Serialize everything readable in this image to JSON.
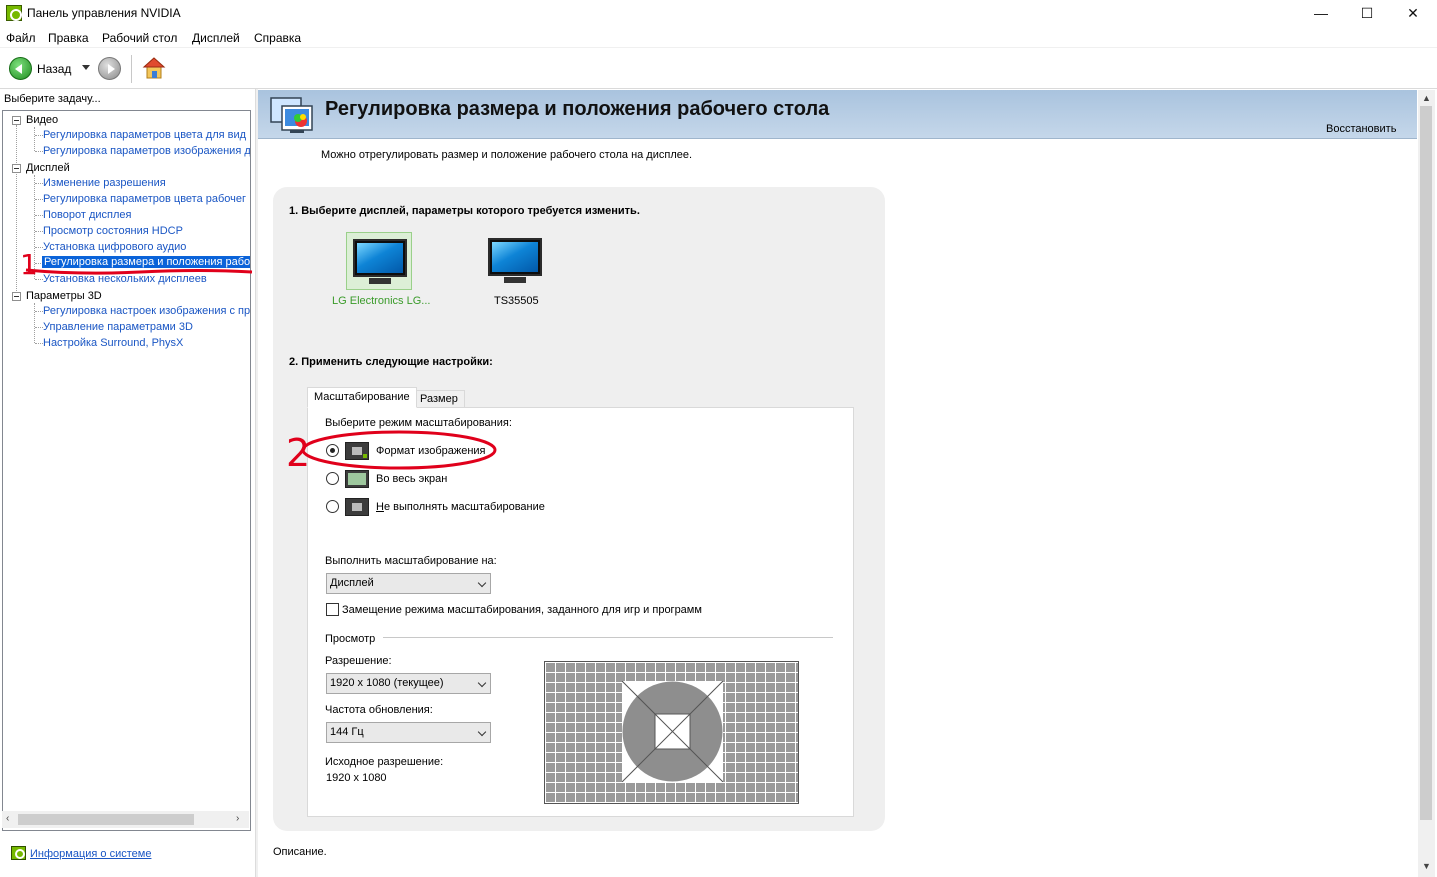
{
  "window": {
    "title": "Панель управления NVIDIA",
    "minimize": "—",
    "maximize": "☐",
    "close": "✕"
  },
  "menu": [
    "Файл",
    "Правка",
    "Рабочий стол",
    "Дисплей",
    "Справка"
  ],
  "toolbar": {
    "back_label": "Назад",
    "back_icon": "back-arrow-icon",
    "forward_icon": "forward-arrow-icon",
    "home_icon": "home-icon"
  },
  "sidebar": {
    "task_label": "Выберите задачу...",
    "categories": [
      {
        "label": "Видео",
        "items": [
          "Регулировка параметров цвета для вид",
          "Регулировка параметров изображения д"
        ]
      },
      {
        "label": "Дисплей",
        "items": [
          "Изменение разрешения",
          "Регулировка параметров цвета рабочег",
          "Поворот дисплея",
          "Просмотр состояния HDCP",
          "Установка цифрового аудио",
          "Регулировка размера и положения рабо",
          "Установка нескольких дисплеев"
        ]
      },
      {
        "label": "Параметры 3D",
        "items": [
          "Регулировка настроек изображения с пр",
          "Управление параметрами 3D",
          "Настройка Surround, PhysX"
        ]
      }
    ],
    "selected_item": "Регулировка размера и положения рабо",
    "system_info_link": "Информация о системе"
  },
  "main": {
    "title": "Регулировка размера и положения рабочего стола",
    "restore_link": "Восстановить",
    "description": "Можно отрегулировать размер и положение рабочего стола на дисплее.",
    "step1_title": "1. Выберите дисплей, параметры которого требуется изменить.",
    "displays": [
      {
        "name": "LG Electronics LG...",
        "selected": true
      },
      {
        "name": "TS35505",
        "selected": false
      }
    ],
    "step2_title": "2. Применить следующие настройки:",
    "tabs": [
      {
        "label": "Масштабирование",
        "active": true
      },
      {
        "label": "Размер",
        "active": false
      }
    ],
    "scaling": {
      "mode_label": "Выберите режим масштабирования:",
      "options": [
        {
          "label": "Формат изображения",
          "checked": true
        },
        {
          "label": "Во весь экран",
          "checked": false
        },
        {
          "label": "Не выполнять масштабирование",
          "checked": false
        }
      ],
      "perform_on_label": "Выполнить масштабирование на:",
      "perform_on_value": "Дисплей",
      "override_label": "Замещение режима масштабирования, заданного для игр и программ",
      "override_checked": false
    },
    "preview": {
      "group_label": "Просмотр",
      "resolution_label": "Разрешение:",
      "resolution_value": "1920 x 1080 (текущее)",
      "refresh_label": "Частота обновления:",
      "refresh_value": "144 Гц",
      "native_label": "Исходное разрешение:",
      "native_value": "1920 x 1080"
    },
    "footer_description": "Описание."
  },
  "annotations": {
    "marker1": "1",
    "marker2": "2",
    "color": "#e0001b"
  },
  "colors": {
    "header_band": "#b7cde4",
    "selection": "#0a63d9",
    "link": "#1a56c4",
    "nvidia_green": "#76b900"
  }
}
